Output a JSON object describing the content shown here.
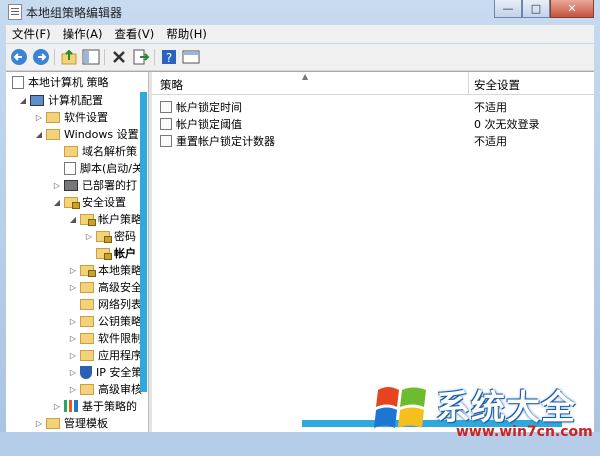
{
  "window": {
    "title": "本地组策略编辑器"
  },
  "menubar": {
    "items": [
      "文件(F)",
      "操作(A)",
      "查看(V)",
      "帮助(H)"
    ]
  },
  "tree": {
    "root": "本地计算机 策略",
    "items": [
      {
        "label": "计算机配置",
        "icon": "computer-icon"
      },
      {
        "label": "软件设置",
        "icon": "folder-icon"
      },
      {
        "label": "Windows 设置",
        "icon": "folder-icon"
      },
      {
        "label": "域名解析策",
        "icon": "folder-icon"
      },
      {
        "label": "脚本(启动/关",
        "icon": "script-icon"
      },
      {
        "label": "已部署的打",
        "icon": "printer-icon"
      },
      {
        "label": "安全设置",
        "icon": "security-folder-icon"
      },
      {
        "label": "帐户策略",
        "icon": "locked-folder-icon"
      },
      {
        "label": "密码",
        "icon": "locked-folder-icon"
      },
      {
        "label": "帐户",
        "icon": "locked-folder-icon"
      },
      {
        "label": "本地策略",
        "icon": "locked-folder-icon"
      },
      {
        "label": "高级安全",
        "icon": "folder-icon"
      },
      {
        "label": "网络列表",
        "icon": "folder-icon"
      },
      {
        "label": "公钥策略",
        "icon": "folder-icon"
      },
      {
        "label": "软件限制",
        "icon": "folder-icon"
      },
      {
        "label": "应用程序",
        "icon": "folder-icon"
      },
      {
        "label": "IP 安全策",
        "icon": "shield-icon"
      },
      {
        "label": "高级审核",
        "icon": "folder-icon"
      },
      {
        "label": "基于策略的",
        "icon": "chart-icon"
      },
      {
        "label": "管理模板",
        "icon": "folder-icon"
      }
    ]
  },
  "list": {
    "columns": [
      "策略",
      "安全设置"
    ],
    "rows": [
      {
        "policy": "帐户锁定时间",
        "value": "不适用"
      },
      {
        "policy": "帐户锁定阈值",
        "value": "0 次无效登录"
      },
      {
        "policy": "重置帐户锁定计数器",
        "value": "不适用"
      }
    ]
  },
  "watermark": {
    "name": "系统大全",
    "url": "www.win7cn.com"
  },
  "colors": {
    "accent": "#2fa9dc",
    "frame": "#b9d1ea"
  }
}
